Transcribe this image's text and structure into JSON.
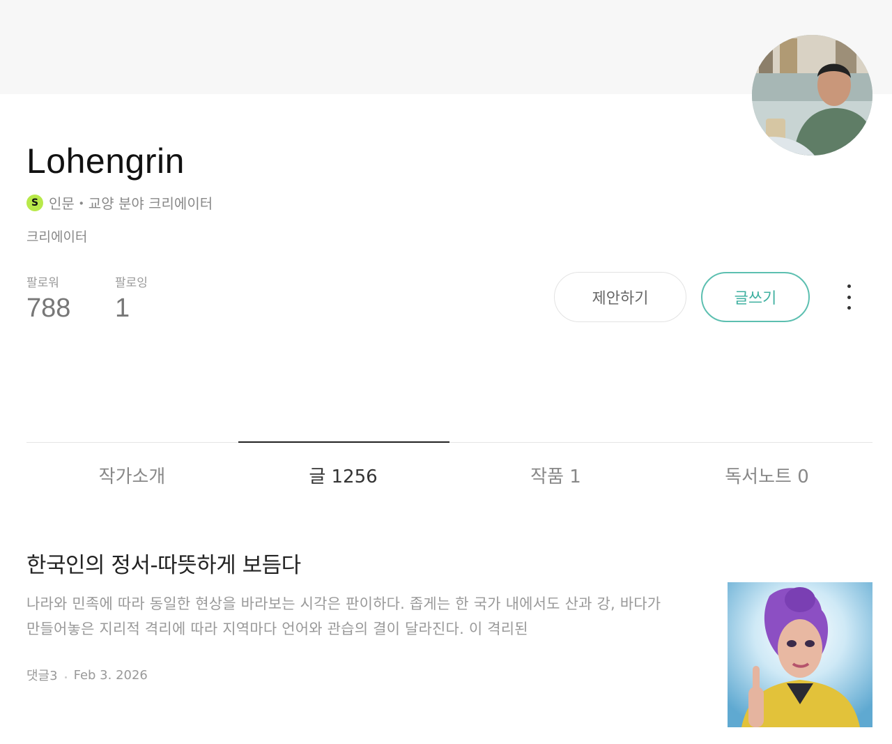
{
  "profile": {
    "name": "Lohengrin",
    "badge": "S",
    "category": "인문・교양 분야 크리에이터",
    "role": "크리에이터",
    "followers_label": "팔로워",
    "followers_count": "788",
    "following_label": "팔로잉",
    "following_count": "1"
  },
  "actions": {
    "propose": "제안하기",
    "write": "글쓰기",
    "more_icon": "more-vertical-icon"
  },
  "tabs": [
    {
      "label": "작가소개",
      "active": false
    },
    {
      "label": "글 1256",
      "active": true
    },
    {
      "label": "작품 1",
      "active": false
    },
    {
      "label": "독서노트 0",
      "active": false
    }
  ],
  "post": {
    "title": "한국인의 정서-따뜻하게 보듬다",
    "excerpt": "나라와 민족에 따라 동일한 현상을 바라보는 시각은 판이하다. 좁게는 한 국가 내에서도 산과 강, 바다가 만들어놓은 지리적 격리에 따라 지역마다 언어와 관습의 결이 달라진다. 이 격리된",
    "comments": "댓글3",
    "date": "Feb 3. 2026"
  },
  "colors": {
    "accent": "#5cbfb0",
    "badge": "#b8e94a",
    "cover": "#f7f7f7"
  }
}
